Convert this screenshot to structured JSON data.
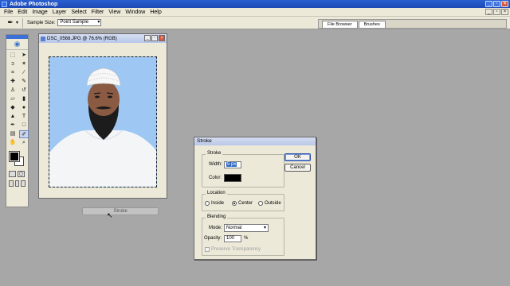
{
  "app": {
    "title": "Adobe Photoshop"
  },
  "menu": [
    "File",
    "Edit",
    "Image",
    "Layer",
    "Select",
    "Filter",
    "View",
    "Window",
    "Help"
  ],
  "options_bar": {
    "sample_size_label": "Sample Size:",
    "sample_size_value": "Point Sample"
  },
  "palette_well": {
    "tabs": [
      "File Browser",
      "Brushes"
    ]
  },
  "document": {
    "title": "DSC_0568.JPG @ 76.6% (RGB)"
  },
  "status_ghost": {
    "label": "Stroke"
  },
  "dialog": {
    "title": "Stroke",
    "stroke_group": "Stroke",
    "width_label": "Width:",
    "width_value": "5 px",
    "color_label": "Color:",
    "color_value": "#000000",
    "location_group": "Location",
    "location_options": [
      "Inside",
      "Center",
      "Outside"
    ],
    "location_selected": "Center",
    "blending_group": "Blending",
    "mode_label": "Mode:",
    "mode_value": "Normal",
    "opacity_label": "Opacity:",
    "opacity_value": "100",
    "opacity_unit": "%",
    "preserve_label": "Preserve Transparency",
    "ok_label": "OK",
    "cancel_label": "Cancel"
  },
  "colors": {
    "foreground": "#000000",
    "background": "#ffffff",
    "canvas_bg": "#a7a7a7"
  }
}
